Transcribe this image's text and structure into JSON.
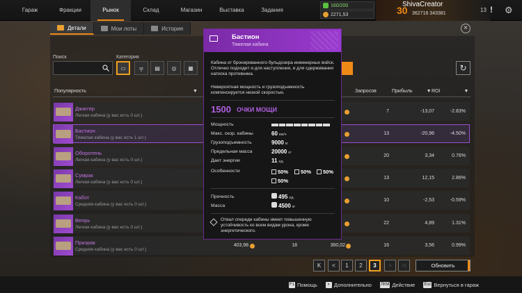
{
  "nav": {
    "items": [
      {
        "label": "Гараж"
      },
      {
        "label": "Фракции"
      },
      {
        "label": "Рынок"
      },
      {
        "label": "Склад"
      },
      {
        "label": "Магазин"
      },
      {
        "label": "Выставка"
      },
      {
        "label": "Задания"
      }
    ],
    "active_index": 2
  },
  "stats": {
    "fuel": "160/200",
    "coins": "2271,53"
  },
  "profile": {
    "name": "ShivaCreator",
    "level": "30",
    "score": "362716 343381",
    "notifications": "13"
  },
  "subtabs": [
    {
      "label": "Детали"
    },
    {
      "label": "Мои лоты"
    },
    {
      "label": "История"
    }
  ],
  "filters": {
    "search_label": "Поиск",
    "search_placeholder": "",
    "category_label": "Категория"
  },
  "columns": {
    "popular": "Популярность",
    "requests": "Запросов",
    "profit": "Прибыль",
    "roi": "ROI"
  },
  "rows": [
    {
      "name": "Джаггер",
      "sub": "Легкая кабина (у вас есть 0 шт.)",
      "requests": "7",
      "profit": "-13,07",
      "roi": "-2.83%"
    },
    {
      "name": "Бастион",
      "sub": "Тяжелая кабина (у вас есть 1 шт.)",
      "requests": "13",
      "profit": "-20,96",
      "roi": "-4.50%"
    },
    {
      "name": "Оборотень",
      "sub": "Легкая кабина (у вас есть 0 шт.)",
      "requests": "20",
      "profit": "3,34",
      "roi": "0.76%"
    },
    {
      "name": "Сумрак",
      "sub": "Легкая кабина (у вас есть 0 шт.)",
      "requests": "13",
      "profit": "12,15",
      "roi": "2.86%"
    },
    {
      "name": "Кабот",
      "sub": "Средняя кабина (у вас есть 0 шт.)",
      "requests": "10",
      "profit": "-2,53",
      "roi": "-0.59%"
    },
    {
      "name": "Вепрь",
      "sub": "Легкая кабина (у вас есть 0 шт.)",
      "requests": "22",
      "profit": "4,89",
      "roi": "1.31%"
    },
    {
      "name": "Призрак",
      "sub": "Средняя кабина (у вас есть 0 шт.)",
      "price": "403,98",
      "qty": "18",
      "price2": "360,02",
      "requests": "16",
      "profit": "3,56",
      "roi": "0.99%"
    }
  ],
  "pager": {
    "first": "K",
    "prev": "<",
    "p1": "1",
    "p2": "2",
    "p3": "3",
    "next": ">",
    "last": ">|",
    "update": "Обновить"
  },
  "footer": {
    "help": "Помощь",
    "more": "Дополнительно",
    "action": "Действие",
    "back": "Вернуться в гараж",
    "help_key": "F1",
    "action_key": "ЛКМ",
    "back_key": "Esc"
  },
  "tooltip": {
    "title": "Бастион",
    "subtitle": "Тяжелая кабина",
    "desc1": "Кабина от бронированного бульдозера инженерных войск. Отлично подходит и для наступления, и для сдерживания натиска противника.",
    "desc2": "Невероятная мощность и грузоподъемность компенсируется низкой скоростью.",
    "power_value": "1500",
    "power_label": "ОЧКИ МОЩИ",
    "stats": [
      {
        "label": "Мощность"
      },
      {
        "label": "Макс. скор. кабины",
        "value": "60",
        "unit": "км/ч"
      },
      {
        "label": "Грузоподъемность",
        "value": "9000",
        "unit": "кг"
      },
      {
        "label": "Предельная масса",
        "value": "20000",
        "unit": "кг"
      },
      {
        "label": "Дает энергии",
        "value": "11",
        "unit": "ед."
      },
      {
        "label": "Особенности"
      }
    ],
    "features": [
      "50%",
      "50%",
      "50%",
      "50%"
    ],
    "durability_label": "Прочность",
    "durability_value": "495",
    "durability_unit": "ед.",
    "mass_label": "Масса",
    "mass_value": "4500",
    "mass_unit": "кг",
    "note": "Отвал спереди кабины имеет повышенную устойчивость ко всем видам урона, кроме энергетического."
  },
  "colors": {
    "accent": "#f08a17",
    "rare": "#9a3ad0",
    "rare_text": "#c274e0"
  }
}
